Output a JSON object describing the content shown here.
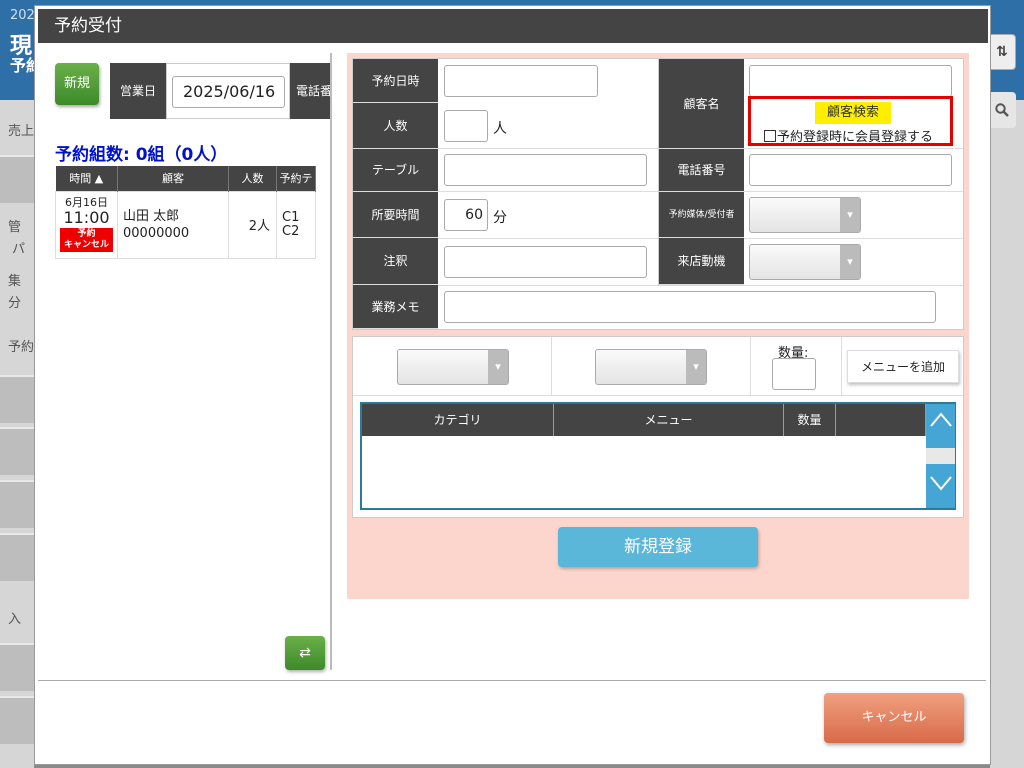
{
  "background": {
    "year_fragment": "202",
    "title_fragment": "現",
    "subtitle_fragment": "予約",
    "side_items": [
      "売上",
      "管",
      "パ",
      "集",
      "分",
      "予約",
      "入"
    ],
    "sort_icon_text": "⇅"
  },
  "modal": {
    "title": "予約受付",
    "new_button": "新規",
    "business_date_label": "営業日",
    "business_date_value": "2025/06/16",
    "tel_label_partial": "電話番",
    "count_text": "予約組数: 0組（0人）",
    "list": {
      "headers": [
        "時間 ▲",
        "顧客",
        "人数",
        "予約テ"
      ],
      "rows": [
        {
          "date": "6月16日",
          "time": "11:00",
          "badge_line1": "予約",
          "badge_line2": "キャンセル",
          "customer_name": "山田 太郎",
          "customer_id": "00000000",
          "people": "2人",
          "table_line1": "C1",
          "table_line2": "C2"
        }
      ]
    },
    "swap_icon": "⇄",
    "form": {
      "reserve_datetime_label": "予約日時",
      "people_label": "人数",
      "people_unit": "人",
      "table_label": "テーブル",
      "duration_label": "所要時間",
      "duration_value": "60",
      "duration_unit": "分",
      "note_label": "注釈",
      "memo_label": "業務メモ",
      "customer_name_label": "顧客名",
      "customer_search_button": "顧客検索",
      "member_register_checkbox": "予約登録時に会員登録する",
      "phone_label": "電話番号",
      "media_label": "予約媒体/受付者",
      "visit_motive_label": "来店動機"
    },
    "menu": {
      "quantity_label": "数量:",
      "add_menu_button": "メニューを追加",
      "headers": [
        "カテゴリ",
        "メニュー",
        "数量",
        ""
      ]
    },
    "register_button": "新規登録",
    "cancel_button": "キャンセル"
  }
}
